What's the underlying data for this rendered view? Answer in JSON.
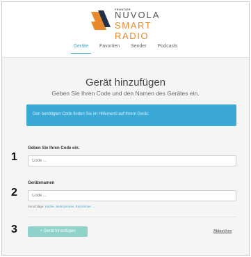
{
  "brand": {
    "small": "FRONTIER",
    "line1": "NUVOLA",
    "line2": "SMART RADIO"
  },
  "nav": {
    "items": [
      {
        "label": "Geräte"
      },
      {
        "label": "Favoriten"
      },
      {
        "label": "Sender"
      },
      {
        "label": "Podcasts"
      }
    ]
  },
  "page": {
    "title": "Gerät hinzufügen",
    "subtitle": "Geben Sie Ihren Code und den Namen des Gerätes ein.",
    "info": "Den benötigten Code finden Sie im Hilfemenü auf Ihrem Gerät."
  },
  "form": {
    "code_label": "Geben Sie Ihren Code ein.",
    "code_placeholder": "Code ...",
    "name_label": "Gerätenamen",
    "name_placeholder": "Code ...",
    "hint_prefix": "Vorschläge:",
    "hint_suggestions": "Küche, Wohnzimmer, Esszimmer ...",
    "submit_label": "+ Gerät hinzufügen",
    "cancel_label": "Abbrechen"
  },
  "markers": {
    "m1": "1",
    "m2": "2",
    "m3": "3"
  },
  "colors": {
    "accent": "#3aa9d6",
    "brand_orange": "#e7892c",
    "brand_navy": "#23304a",
    "submit_disabled": "#8fd2c9"
  }
}
